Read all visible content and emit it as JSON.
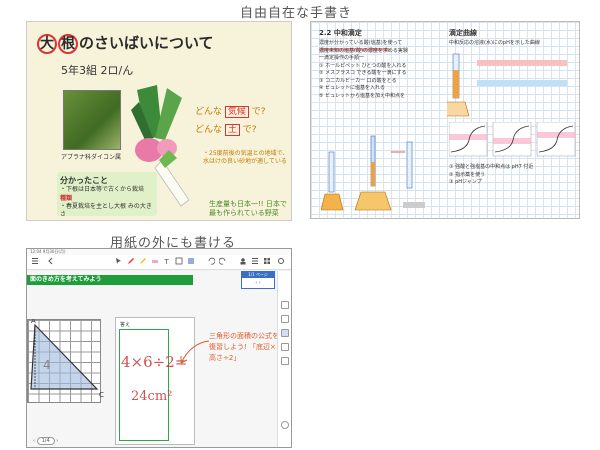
{
  "captions": {
    "top": "自由自在な手書き",
    "bottom": "用紙の外にも書ける"
  },
  "note1": {
    "title_char1": "大",
    "title_char2": "根",
    "title_rest": "のさいばいについて",
    "class": "5年3組 2ロ/ん",
    "photo_caption": "アブラナ科ダイコン属",
    "q1_prefix": "どんな",
    "q1_box": "気候",
    "q1_suffix": "で?",
    "q2_prefix": "どんな",
    "q2_box": "土",
    "q2_suffix": "で?",
    "note": "・25度前後の気温との地域で、水はけの良い砂地が適している",
    "know_heading": "分かったこと",
    "know_line1": "・下根は日本等で古くから栽培",
    "know_red": "種類",
    "know_line2": "・春夏栽培を主とし大根 みの大きさ",
    "production": "生産量も日本一!! 日本で最も作られている野菜"
  },
  "note2": {
    "heading_left": "2.2 中和滴定",
    "heading_right": "滴定曲線",
    "lines_left": [
      "濃度が分かっている酸(塩基)を使って",
      "濃度未知の塩基(酸)の濃度を求める実験",
      "一滴定操作の手順一",
      "① ホールピペット ひとつの酸を入れる",
      "② メスフラスコ できる酸を一滴にする",
      "③ コニカルビーカー 口の酸をとる",
      "④ ビュレットに塩基を入れる",
      "⑤ ビュレットから塩基を加え中和点を"
    ],
    "lines_right": [
      "中和反応の溶液(水)にのpHを示した曲線",
      "① 強酸と強塩基の中和点は pH7 付近",
      "② 指示薬を使う",
      "③ pHジャンプ"
    ]
  },
  "tablet": {
    "status": "12:04  9月30日(月)",
    "banner": "面のきめ方を考えてみよう",
    "paper_label": "答え",
    "handwriting_eq": "4×6÷2=",
    "handwriting_ans": "24cm²",
    "hint": "三角形の面積の公式を復習しよう! 「底辺×高さ÷2」",
    "pages_label": "1/1 ページ",
    "pages_nav": "‹  ›",
    "page_indicator": "1/4"
  }
}
